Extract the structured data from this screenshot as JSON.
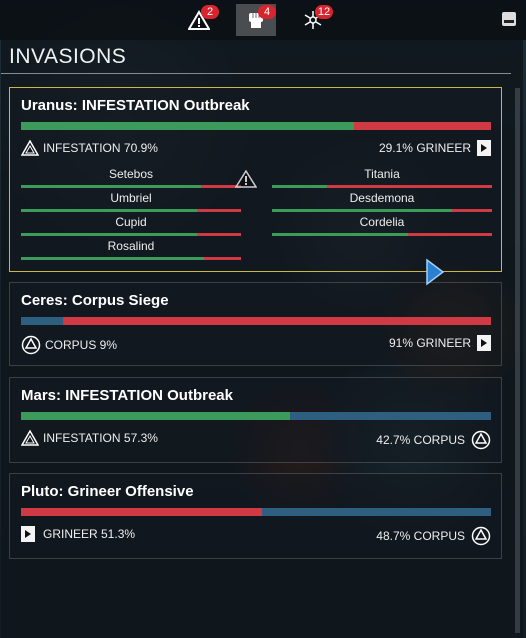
{
  "colors": {
    "infestation": "#3c9a5a",
    "grineer": "#d03a44",
    "corpus": "#2e5f80"
  },
  "topbar": {
    "alerts": {
      "icon": "alert-triangle-icon",
      "count": "2"
    },
    "invasions": {
      "icon": "fist-icon",
      "count": "4"
    },
    "syndicates": {
      "icon": "network-icon",
      "count": "12"
    }
  },
  "panel": {
    "title": "INVASIONS"
  },
  "invasions": [
    {
      "title": "Uranus: INFESTATION Outbreak",
      "left_label": "INFESTATION 70.9%",
      "right_label": "29.1% GRINEER",
      "left_faction": "infestation",
      "right_faction": "grineer",
      "left_pct": 70.9,
      "nodes": [
        {
          "name": "Setebos",
          "left_pct": 0.82
        },
        {
          "name": "Titania",
          "left_pct": 0.25
        },
        {
          "name": "Umbriel",
          "left_pct": 0.8
        },
        {
          "name": "Desdemona",
          "left_pct": 0.82
        },
        {
          "name": "Cupid",
          "left_pct": 0.8
        },
        {
          "name": "Cordelia",
          "left_pct": 0.62
        },
        {
          "name": "Rosalind",
          "left_pct": 0.83
        }
      ]
    },
    {
      "title": "Ceres: Corpus Siege",
      "left_label": "CORPUS 9%",
      "right_label": "91% GRINEER",
      "left_faction": "corpus",
      "right_faction": "grineer",
      "left_pct": 9
    },
    {
      "title": "Mars: INFESTATION Outbreak",
      "left_label": "INFESTATION 57.3%",
      "right_label": "42.7% CORPUS",
      "left_faction": "infestation",
      "right_faction": "corpus",
      "left_pct": 57.3
    },
    {
      "title": "Pluto: Grineer Offensive",
      "left_label": "GRINEER 51.3%",
      "right_label": "48.7% CORPUS",
      "left_faction": "grineer",
      "right_faction": "corpus",
      "left_pct": 51.3
    }
  ]
}
